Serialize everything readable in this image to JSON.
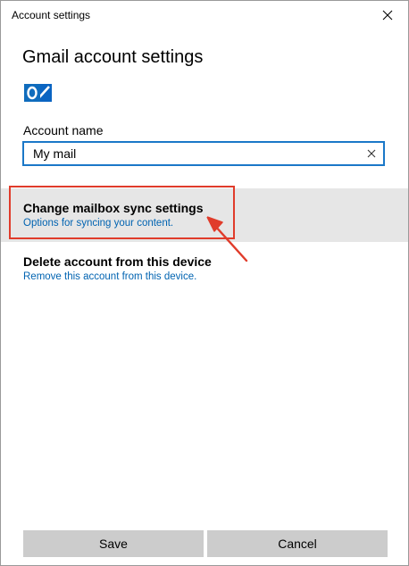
{
  "window": {
    "title": "Account settings",
    "close_icon": "close-icon"
  },
  "header": {
    "heading": "Gmail account settings",
    "provider_icon": "outlook-icon"
  },
  "account": {
    "label": "Account name",
    "value": "My mail",
    "clear_icon": "clear-icon"
  },
  "options": [
    {
      "title": "Change mailbox sync settings",
      "subtitle": "Options for syncing your content."
    },
    {
      "title": "Delete account from this device",
      "subtitle": "Remove this account from this device."
    }
  ],
  "annotation": {
    "color": "#e03c2b"
  },
  "buttons": {
    "save": "Save",
    "cancel": "Cancel"
  },
  "colors": {
    "accent": "#1b78c8",
    "link": "#0063b1",
    "selected_row": "#e6e6e6",
    "button_bg": "#cccccc"
  }
}
